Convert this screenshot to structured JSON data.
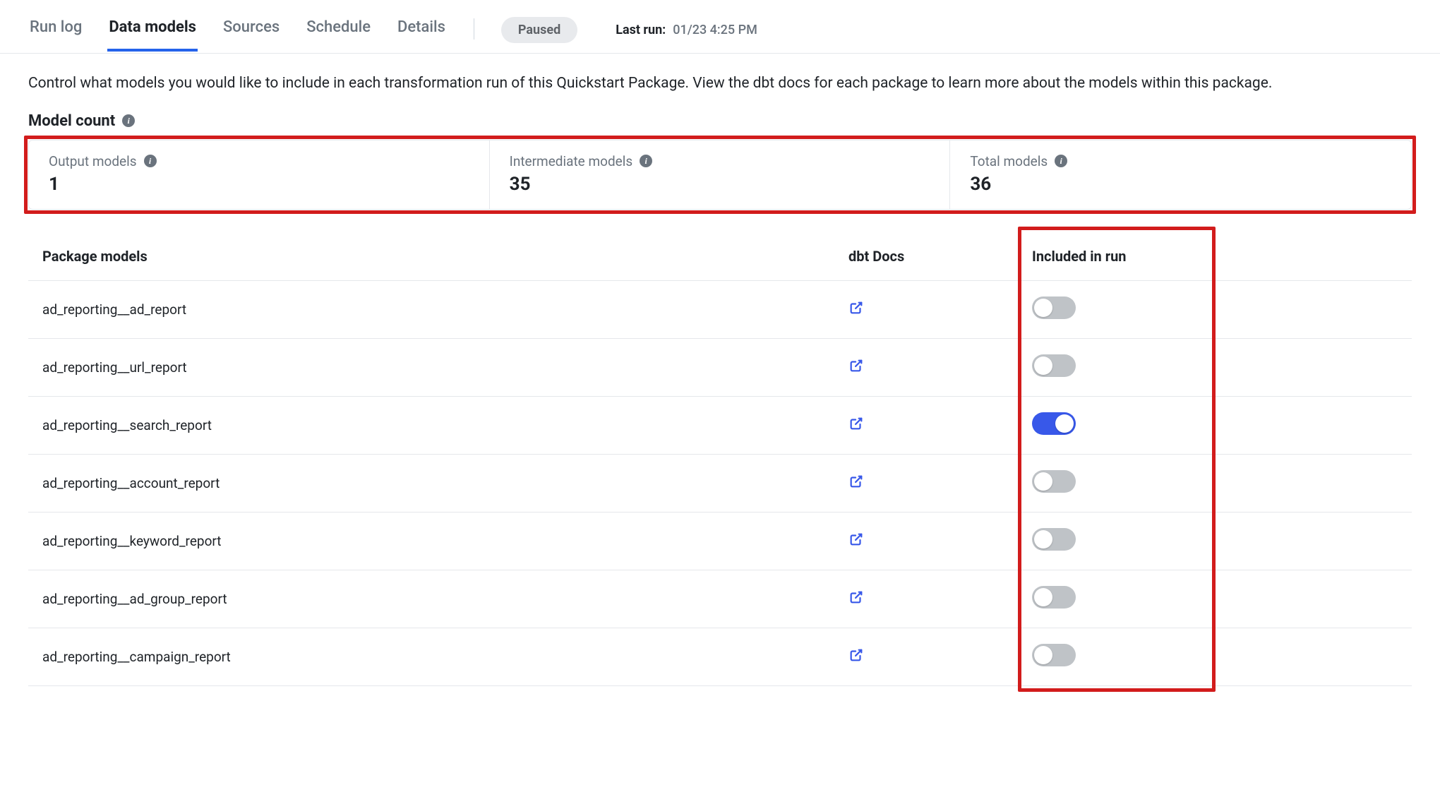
{
  "tabs": [
    {
      "id": "run-log",
      "label": "Run log",
      "active": false
    },
    {
      "id": "data-models",
      "label": "Data models",
      "active": true
    },
    {
      "id": "sources",
      "label": "Sources",
      "active": false
    },
    {
      "id": "schedule",
      "label": "Schedule",
      "active": false
    },
    {
      "id": "details",
      "label": "Details",
      "active": false
    }
  ],
  "status": {
    "label": "Paused"
  },
  "last_run": {
    "label": "Last run:",
    "value": "01/23 4:25 PM"
  },
  "intro": "Control what models you would like to include in each transformation run of this Quickstart Package. View the dbt docs for each package to learn more about the models within this package.",
  "model_count": {
    "title": "Model count",
    "cells": [
      {
        "label": "Output models",
        "value": "1"
      },
      {
        "label": "Intermediate models",
        "value": "35"
      },
      {
        "label": "Total models",
        "value": "36"
      }
    ]
  },
  "table": {
    "headers": {
      "name": "Package models",
      "docs": "dbt Docs",
      "include": "Included in run"
    },
    "rows": [
      {
        "name": "ad_reporting__ad_report",
        "included": false
      },
      {
        "name": "ad_reporting__url_report",
        "included": false
      },
      {
        "name": "ad_reporting__search_report",
        "included": true
      },
      {
        "name": "ad_reporting__account_report",
        "included": false
      },
      {
        "name": "ad_reporting__keyword_report",
        "included": false
      },
      {
        "name": "ad_reporting__ad_group_report",
        "included": false
      },
      {
        "name": "ad_reporting__campaign_report",
        "included": false
      }
    ]
  }
}
